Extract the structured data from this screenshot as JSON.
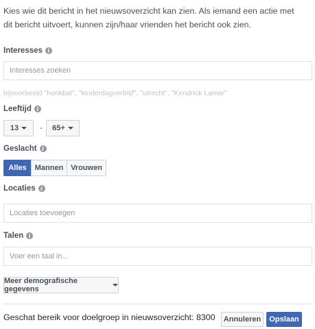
{
  "intro_text": "Kies wie dit bericht in het nieuwsoverzicht kan zien. Als iemand een actie met dit bericht uitvoert, kunnen zijn/haar vrienden het bericht ook zien.",
  "interests": {
    "label": "Interesses",
    "placeholder": "Interesses zoeken",
    "hint": "bijvoorbeeld \"honkbal\", \"kinderdagverblijf\", \"utrecht\", \"Kendrick Lamar\""
  },
  "age": {
    "label": "Leeftijd",
    "min": "13",
    "separator": "-",
    "max": "65+"
  },
  "gender": {
    "label": "Geslacht",
    "options": [
      "Alles",
      "Mannen",
      "Vrouwen"
    ],
    "selected": "Alles"
  },
  "locations": {
    "label": "Locaties",
    "placeholder": "Locaties toevoegen"
  },
  "languages": {
    "label": "Talen",
    "placeholder": "Voer een taal in..."
  },
  "more_demographics_label": "Meer demografische gegevens",
  "footer": {
    "reach_text": "Geschat bereik voor doelgroep in nieuwsoverzicht: 8300",
    "cancel_label": "Annuleren",
    "save_label": "Opslaan"
  },
  "colors": {
    "accent": "#4267b2",
    "border": "#dddfe2"
  },
  "icons": {
    "info": "info-icon",
    "dropdown": "caret-down-icon"
  }
}
